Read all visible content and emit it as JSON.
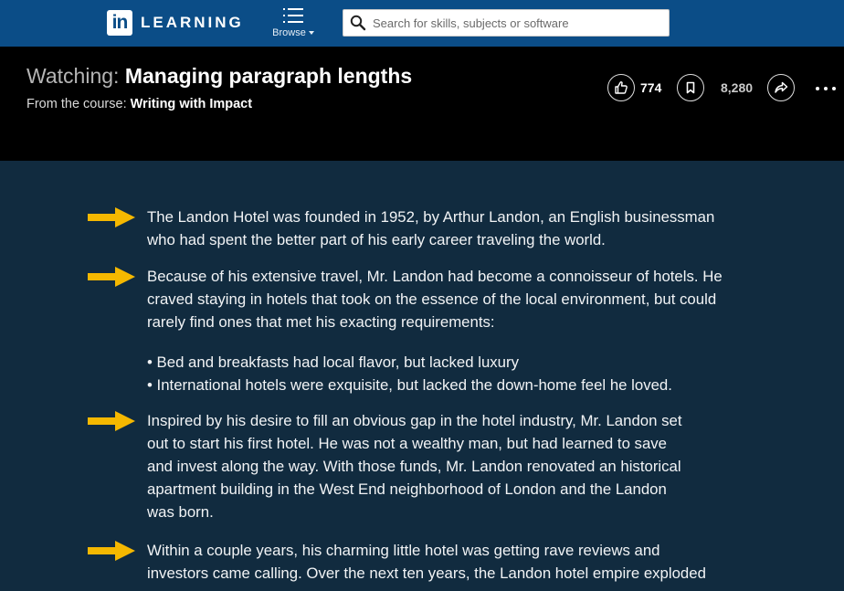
{
  "brand": {
    "logo_mark": "in",
    "name": "LEARNING",
    "color": "#0b4d87"
  },
  "nav": {
    "browse_label": "Browse",
    "browse_icon": "list-icon"
  },
  "search": {
    "placeholder": "Search for skills, subjects or software",
    "value": "",
    "icon": "search-icon"
  },
  "video": {
    "watching_prefix": "Watching:",
    "title": "Managing paragraph lengths",
    "course_prefix": "From the course:",
    "course_name": "Writing with Impact",
    "likes": "774",
    "saves": "8,280"
  },
  "slide": {
    "arrow_color": "#f5b800",
    "paragraphs": [
      {
        "lines": [
          "The Landon Hotel was founded in 1952, by Arthur Landon, an English businessman",
          "who had spent the better part of his early career traveling the world."
        ]
      },
      {
        "lines": [
          "Because of his extensive travel, Mr. Landon had become a connoisseur of hotels. He",
          "craved staying in hotels that took on the essence of the local environment, but could",
          "rarely find ones that met his exacting requirements:"
        ]
      },
      {
        "bullets": [
          "• Bed and breakfasts had local flavor, but lacked luxury",
          "• International hotels were exquisite, but lacked the down-home feel he loved."
        ]
      },
      {
        "lines": [
          "Inspired by his desire to fill an obvious gap in the hotel industry, Mr. Landon set",
          "out to start his first hotel. He was not a wealthy man, but had learned to save",
          "and invest along the way. With those funds, Mr. Landon renovated an historical",
          "apartment building in the West End neighborhood of London and the Landon",
          "was born."
        ]
      },
      {
        "lines": [
          "Within a couple years, his charming little hotel was getting rave reviews and",
          "investors came calling. Over the next ten years, the Landon hotel empire exploded"
        ]
      }
    ]
  }
}
